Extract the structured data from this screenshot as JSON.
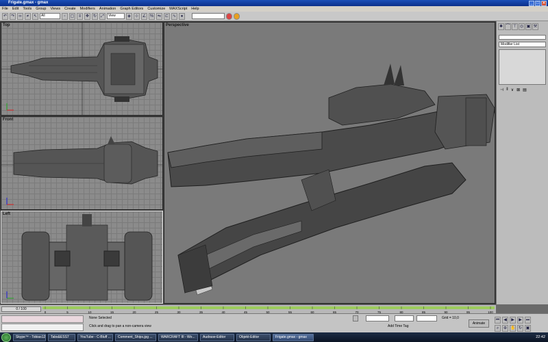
{
  "window": {
    "title": "Frigate.gmax - gmax"
  },
  "menu": [
    "File",
    "Edit",
    "Tools",
    "Group",
    "Views",
    "Create",
    "Modifiers",
    "Animation",
    "Graph Editors",
    "Customize",
    "MAXScript",
    "Help"
  ],
  "toolbar": {
    "selection_filter": "All",
    "ref_coord": "View"
  },
  "viewports": {
    "top": {
      "label": "Top"
    },
    "front": {
      "label": "Front"
    },
    "left": {
      "label": "Left"
    },
    "perspective": {
      "label": "Perspective"
    }
  },
  "command_panel": {
    "modifier_list": "Modifier List"
  },
  "timeline": {
    "frame": "0 / 100",
    "ticks": [
      "0",
      "5",
      "10",
      "15",
      "20",
      "25",
      "30",
      "35",
      "40",
      "45",
      "50",
      "55",
      "60",
      "65",
      "70",
      "75",
      "80",
      "85",
      "90",
      "95",
      "100"
    ]
  },
  "status": {
    "selection": "None Selected",
    "prompt": "Click and drag to pan a non-camera view",
    "grid": "Grid = 10,0",
    "add_time_tag": "Add Time Tag",
    "animate": "Animate"
  },
  "taskbar": {
    "items": [
      "Skype™ - Tobias123...",
      "Tabs&ESS7",
      "YouTube - C-Bluff ...",
      "Comment_Ships.jpg ...",
      "WARCRAFT III - Wo...",
      "Audrase-Editor",
      "Objekt-Editor",
      "Frigate.gmax - gmax"
    ],
    "clock": "22:42"
  },
  "colors": {
    "title_bar": "#0b2f8a",
    "viewport_bg": "#8a8a8a",
    "perspective_bg": "#7a7a7a",
    "model_gray": "#4a4a4a"
  }
}
